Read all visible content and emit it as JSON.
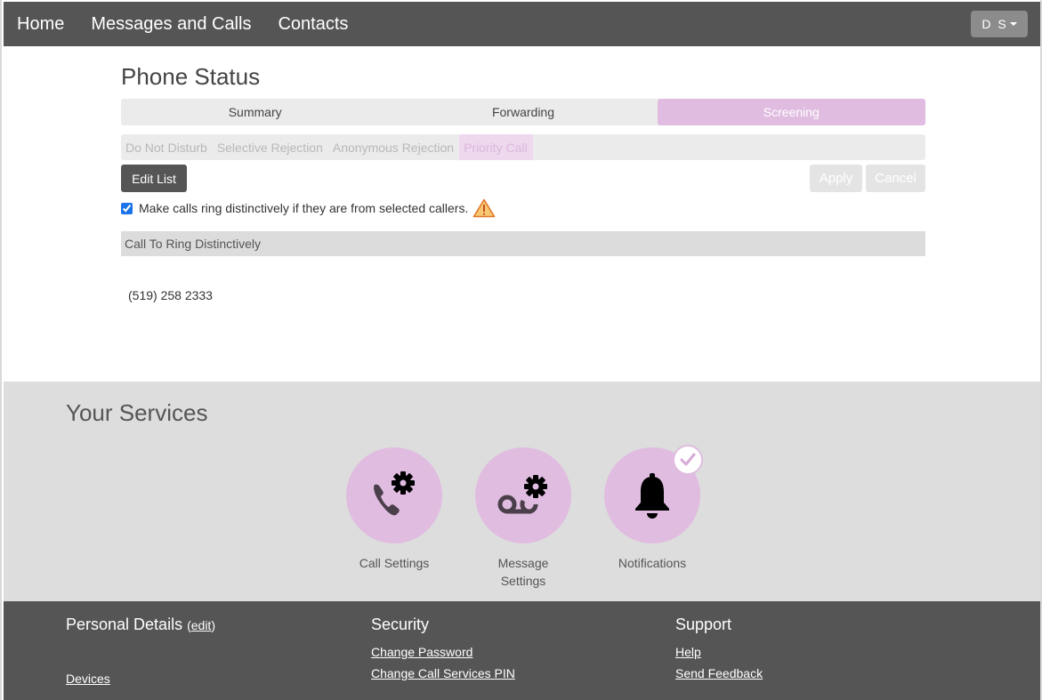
{
  "nav": {
    "links": [
      "Home",
      "Messages and Calls",
      "Contacts"
    ],
    "user_initials": "D S"
  },
  "phone_status": {
    "title": "Phone Status",
    "tabs": [
      {
        "label": "Summary",
        "active": false
      },
      {
        "label": "Forwarding",
        "active": false
      },
      {
        "label": "Screening",
        "active": true
      }
    ],
    "subtabs": [
      {
        "label": "Do Not Disturb",
        "active": false
      },
      {
        "label": "Selective Rejection",
        "active": false
      },
      {
        "label": "Anonymous Rejection",
        "active": false
      },
      {
        "label": "Priority Call",
        "active": true
      }
    ],
    "edit_list_label": "Edit List",
    "apply_label": "Apply",
    "cancel_label": "Cancel",
    "checkbox_label": "Make calls ring distinctively if they are from selected callers.",
    "checkbox_checked": true,
    "list_header": "Call To Ring Distinctively",
    "list_items": [
      "(519) 258 2333"
    ]
  },
  "services": {
    "title": "Your Services",
    "items": [
      {
        "label": "Call Settings",
        "icon": "phone-gear-icon"
      },
      {
        "label": "Message Settings",
        "icon": "voicemail-gear-icon"
      },
      {
        "label": "Notifications",
        "icon": "bell-icon",
        "enabled": true
      }
    ]
  },
  "footer": {
    "personal": {
      "title": "Personal Details",
      "edit_label": "edit",
      "links": [
        "Devices"
      ]
    },
    "security": {
      "title": "Security",
      "links": [
        "Change Password",
        "Change Call Services PIN"
      ]
    },
    "support": {
      "title": "Support",
      "links": [
        "Help",
        "Send Feedback"
      ]
    }
  },
  "colors": {
    "nav_bg": "#555555",
    "accent": "#e0bce0",
    "services_bg": "#dddddd"
  }
}
